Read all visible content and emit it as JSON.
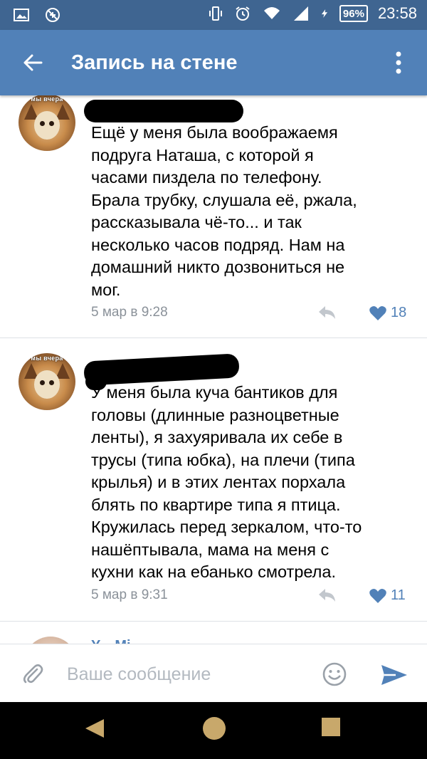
{
  "status_bar": {
    "battery": "96%",
    "time": "23:58"
  },
  "app_bar": {
    "title": "Запись на стене"
  },
  "avatar_caption": "мы вчера",
  "comments": [
    {
      "text": "Ещё у меня была воображаемя\nподруга Наташа, с которой я\nчасами пиздела по телефону.\nБрала трубку, слушала её, ржала,\nрассказывала чё-то... и так\nнесколько часов подряд. Нам на\nдомашний никто дозвониться не\nмог.",
      "date": "5 мар в 9:28",
      "likes": "18"
    },
    {
      "text": "У меня была куча бантиков для\nголовы (длинные разноцветные\nленты), я захуяривала их себе в\nтрусы (типа юбка), на плечи (типа\nкрылья) и в этих лентах порхала\nблять по квартире типа я птица.\nКружилась перед зеркалом, что-то\nнашёптывала, мама на меня с\nкухни как на ебанько смотрела.",
      "date": "5 мар в 9:31",
      "likes": "11"
    }
  ],
  "next_comment": {
    "name_partial": "Y... Mi..."
  },
  "composer": {
    "placeholder": "Ваше сообщение"
  },
  "colors": {
    "status_bar": "#3f6591",
    "app_bar": "#5181b8",
    "accent": "#5181b8",
    "meta_gray": "#8a9199",
    "navbar": "#000000",
    "nav_icons": "#c8a86b"
  },
  "icons": [
    "image-icon",
    "no-location-icon",
    "vibrate-icon",
    "alarm-icon",
    "wifi-icon",
    "signal-icon",
    "charging-icon",
    "back-arrow-icon",
    "more-vert-icon",
    "reply-icon",
    "heart-icon",
    "attach-icon",
    "emoji-icon",
    "send-icon",
    "nav-back-icon",
    "nav-home-icon",
    "nav-recents-icon"
  ]
}
